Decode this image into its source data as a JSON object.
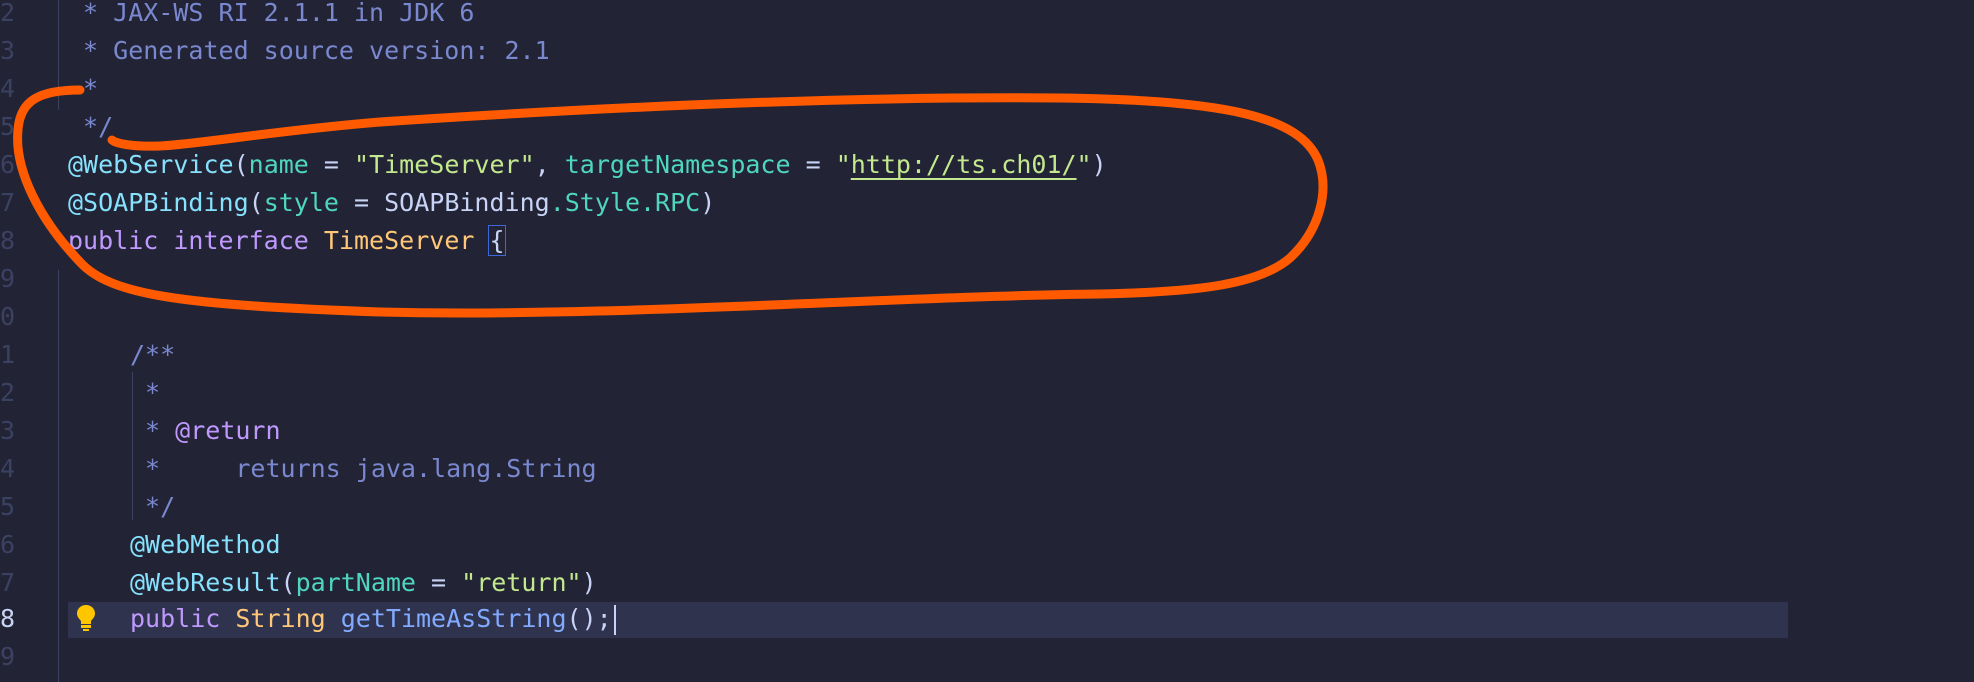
{
  "editor": {
    "lines": [
      {
        "num": "2",
        "text": " * JAX-WS RI 2.1.1 in JDK 6"
      },
      {
        "num": "3",
        "text": " * Generated source version: 2.1"
      },
      {
        "num": "4",
        "text": " *"
      },
      {
        "num": "5",
        "text": " */"
      },
      {
        "num": "6"
      },
      {
        "num": "7"
      },
      {
        "num": "8"
      },
      {
        "num": "9"
      },
      {
        "num": "0"
      },
      {
        "num": "1",
        "text": "/**"
      },
      {
        "num": "2",
        "text": " *"
      },
      {
        "num": "3"
      },
      {
        "num": "4"
      },
      {
        "num": "5",
        "text": " */"
      },
      {
        "num": "6",
        "text": "@WebMethod"
      },
      {
        "num": "7"
      },
      {
        "num": "8"
      },
      {
        "num": "9"
      }
    ],
    "tokens": {
      "webservice": "@WebService",
      "paren_open": "(",
      "name_attr": "name",
      "eq": " = ",
      "name_val": "\"TimeServer\"",
      "comma": ", ",
      "ns_attr": "targetNamespace",
      "quote_open": "\"",
      "ns_url": "http://ts.ch01/",
      "quote_close": "\"",
      "paren_close": ")",
      "soapbinding": "@SOAPBinding",
      "style_attr": "style",
      "style_val": "SOAPBinding",
      "style_rest": ".Style.RPC",
      "kw_public": "public",
      "kw_interface": "interface",
      "iface_name": "TimeServer",
      "brace": "{",
      "doc_star": " * ",
      "doc_return_tag": "@return",
      "doc_star2": " *     ",
      "doc_returns": "returns java.lang.String",
      "webresult": "@WebResult",
      "part_attr": "partName",
      "part_val": "\"return\"",
      "type_string": "String",
      "method_name": "getTimeAsString",
      "method_end": "();"
    },
    "colors": {
      "background": "#222436",
      "current_line": "#2f334d",
      "annotation_stroke": "#ff5a00"
    },
    "icons": {
      "lightbulb": "lightbulb-icon"
    }
  }
}
